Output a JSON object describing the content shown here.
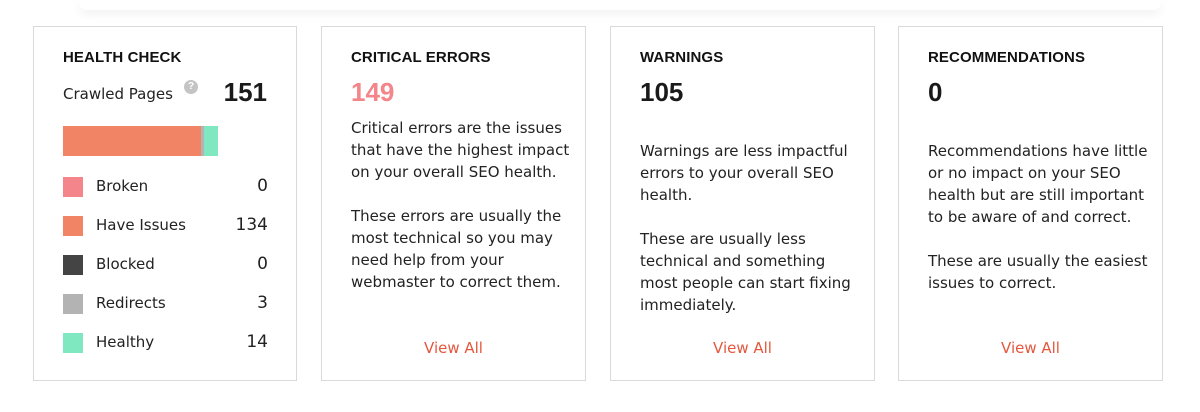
{
  "health_check": {
    "title": "HEALTH CHECK",
    "crawled_label": "Crawled Pages",
    "help_glyph": "?",
    "crawled_count": "151",
    "legend": [
      {
        "key": "broken",
        "label": "Broken",
        "value": "0",
        "count": 0,
        "color": "#f4858a"
      },
      {
        "key": "have-issues",
        "label": "Have Issues",
        "value": "134",
        "count": 134,
        "color": "#f08465"
      },
      {
        "key": "blocked",
        "label": "Blocked",
        "value": "0",
        "count": 0,
        "color": "#444444"
      },
      {
        "key": "redirects",
        "label": "Redirects",
        "value": "3",
        "count": 3,
        "color": "#b3b3b3"
      },
      {
        "key": "healthy",
        "label": "Healthy",
        "value": "14",
        "count": 14,
        "color": "#7fe8c1"
      }
    ]
  },
  "critical": {
    "title": "CRITICAL ERRORS",
    "count": "149",
    "paragraphs": [
      "Critical errors are the issues that have the highest impact on your overall SEO health.",
      "These errors are usually the most technical so you may need help from your webmaster to correct them."
    ],
    "link": "View All"
  },
  "warnings": {
    "title": "WARNINGS",
    "count": "105",
    "paragraphs": [
      "Warnings are less impactful errors to your overall SEO health.",
      "These are usually less technical and something most people can start fixing immediately."
    ],
    "link": "View All"
  },
  "recommendations": {
    "title": "RECOMMENDATIONS",
    "count": "0",
    "paragraphs": [
      "Recommendations have little or no impact on your SEO health but are still important to be aware of and correct.",
      "These are usually the easiest issues to correct."
    ],
    "link": "View All"
  },
  "colors": {
    "accent_link": "#e4573d",
    "critical_count": "#f4858a"
  }
}
